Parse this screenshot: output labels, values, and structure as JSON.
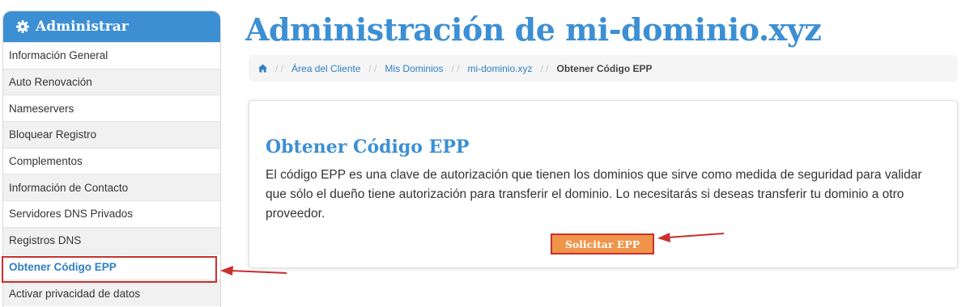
{
  "sidebar": {
    "title": "Administrar",
    "items": [
      {
        "label": "Información General"
      },
      {
        "label": "Auto Renovación"
      },
      {
        "label": "Nameservers"
      },
      {
        "label": "Bloquear Registro"
      },
      {
        "label": "Complementos"
      },
      {
        "label": "Información de Contacto"
      },
      {
        "label": "Servidores DNS Privados"
      },
      {
        "label": "Registros DNS"
      },
      {
        "label": "Obtener Código EPP"
      },
      {
        "label": "Activar privacidad de datos"
      }
    ]
  },
  "page": {
    "title": "Administración de mi-dominio.xyz"
  },
  "breadcrumb": {
    "items": [
      "Área del Cliente",
      "Mis Dominios",
      "mi-dominio.xyz"
    ],
    "current": "Obtener Código EPP",
    "separator": "/ /"
  },
  "panel": {
    "title": "Obtener Código EPP",
    "text": "El código EPP es una clave de autorización que tienen los dominios que sirve como medida de seguridad para validar que sólo el dueño tiene autorización para transferir el dominio. Lo necesitarás si deseas transferir tu dominio a otro proveedor.",
    "button_label": "Solicitar EPP"
  },
  "colors": {
    "accent": "#3d8fd3",
    "button": "#f0944a",
    "highlight": "#c8302e"
  },
  "icons": {
    "sidebar_header": "gear-icon",
    "breadcrumb_home": "home-icon"
  }
}
